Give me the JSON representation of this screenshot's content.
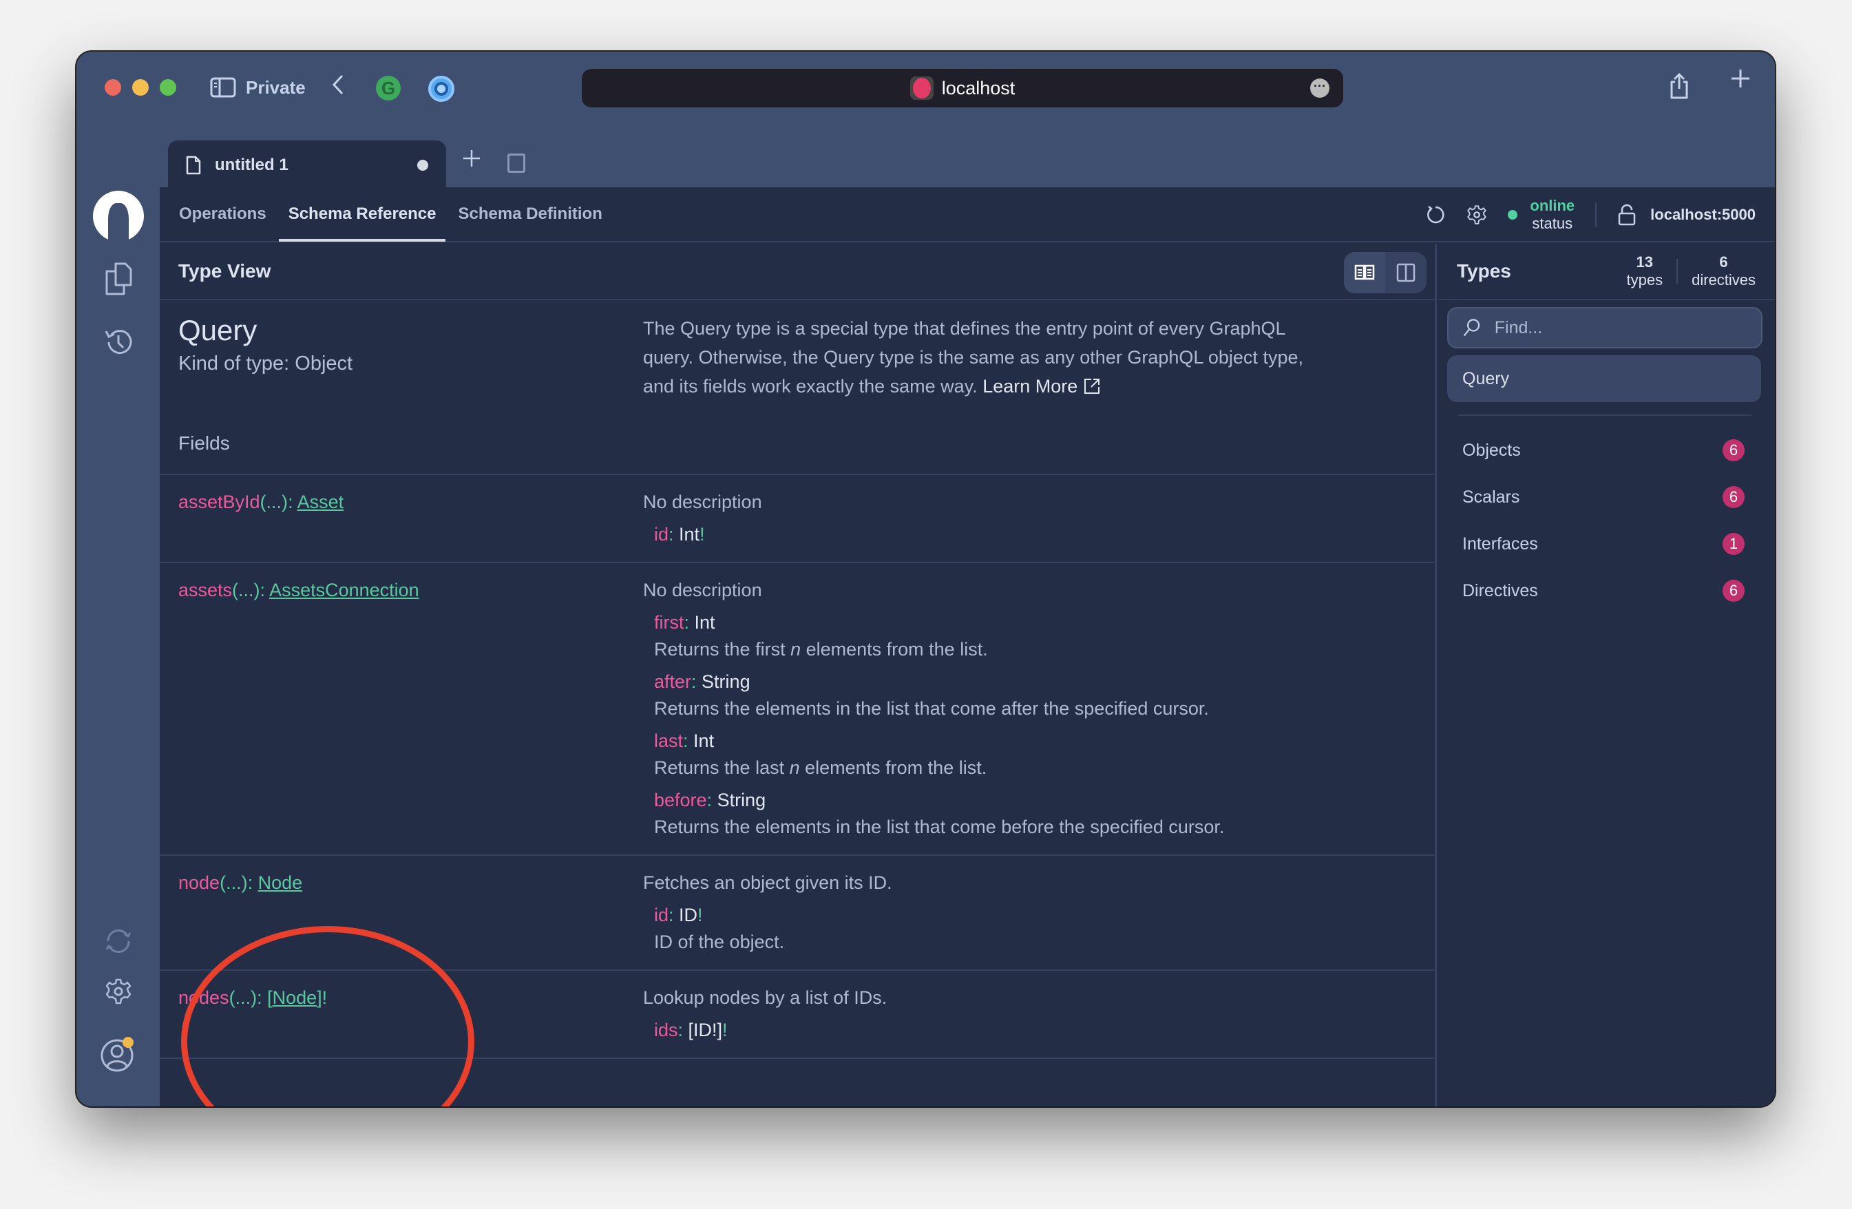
{
  "browser": {
    "private_label": "Private",
    "url": "localhost",
    "ext_g_label": "G"
  },
  "doc_tab": {
    "title": "untitled 1"
  },
  "nav": {
    "tabs": [
      {
        "label": "Operations",
        "active": false
      },
      {
        "label": "Schema Reference",
        "active": true
      },
      {
        "label": "Schema Definition",
        "active": false
      }
    ],
    "status_value": "online",
    "status_label": "status",
    "endpoint": "localhost:5000",
    "status_color": "#4fd1a0"
  },
  "main": {
    "header": "Type View",
    "type_name": "Query",
    "kind": "Kind of type: Object",
    "description": "The Query type is a special type that defines the entry point of every GraphQL query. Otherwise, the Query type is the same as any other GraphQL object type, and its fields work exactly the same way.",
    "learn_more": "Learn More",
    "fields_label": "Fields",
    "fields": [
      {
        "name": "assetById",
        "args_hint": "(...)",
        "type_prefix": "",
        "type": "Asset",
        "type_suffix": "",
        "description": "No description",
        "args": [
          {
            "name": "id",
            "type": "Int",
            "bang": "!",
            "description": ""
          }
        ]
      },
      {
        "name": "assets",
        "args_hint": "(...)",
        "type_prefix": "",
        "type": "AssetsConnection",
        "type_suffix": "",
        "description": "No description",
        "args": [
          {
            "name": "first",
            "type": "Int",
            "bang": "",
            "description": "Returns the first n elements from the list."
          },
          {
            "name": "after",
            "type": "String",
            "bang": "",
            "description": "Returns the elements in the list that come after the specified cursor."
          },
          {
            "name": "last",
            "type": "Int",
            "bang": "",
            "description": "Returns the last n elements from the list."
          },
          {
            "name": "before",
            "type": "String",
            "bang": "",
            "description": "Returns the elements in the list that come before the specified cursor."
          }
        ]
      },
      {
        "name": "node",
        "args_hint": "(...)",
        "type_prefix": "",
        "type": "Node",
        "type_suffix": "",
        "description": "Fetches an object given its ID.",
        "args": [
          {
            "name": "id",
            "type": "ID",
            "bang": "!",
            "description": "ID of the object."
          }
        ]
      },
      {
        "name": "nodes",
        "args_hint": "(...)",
        "type_prefix": "[",
        "type": "Node",
        "type_suffix": "]!",
        "description": "Lookup nodes by a list of IDs.",
        "args": [
          {
            "name": "ids",
            "type": "[ID!]",
            "bang": "!",
            "description": ""
          }
        ]
      }
    ]
  },
  "types_panel": {
    "title": "Types",
    "types_count": "13",
    "types_label": "types",
    "directives_count": "6",
    "directives_label": "directives",
    "find_placeholder": "Find...",
    "selected": "Query",
    "categories": [
      {
        "label": "Objects",
        "count": "6"
      },
      {
        "label": "Scalars",
        "count": "6"
      },
      {
        "label": "Interfaces",
        "count": "1"
      },
      {
        "label": "Directives",
        "count": "6"
      }
    ],
    "badge_color": "#c1316d"
  },
  "annotation": {
    "color": "#e8402c"
  }
}
